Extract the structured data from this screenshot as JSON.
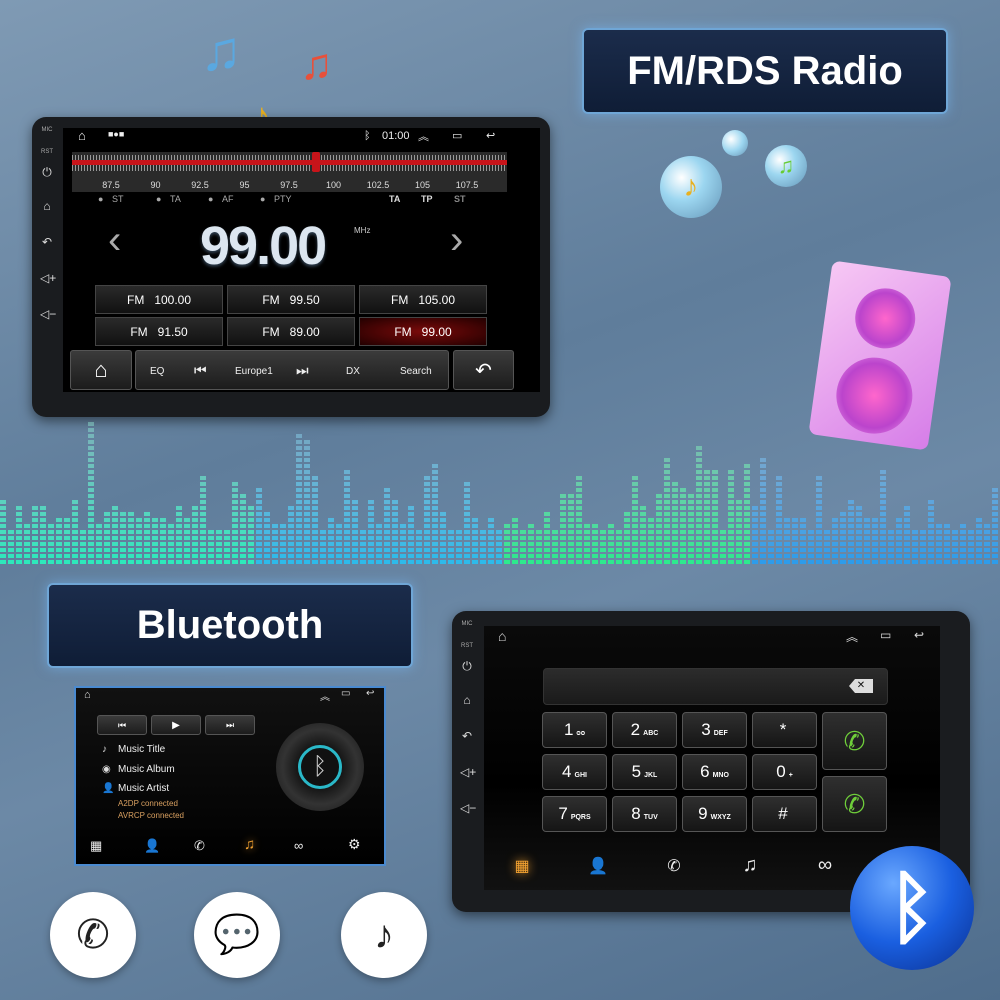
{
  "banners": {
    "radio": "FM/RDS Radio",
    "bluetooth": "Bluetooth"
  },
  "radio": {
    "side_labels": {
      "mic": "MIC",
      "rst": "RST"
    },
    "time": "01:00",
    "band_ticks": [
      "87.5",
      "90",
      "92.5",
      "95",
      "97.5",
      "100",
      "102.5",
      "105",
      "107.5"
    ],
    "tuner_value_mhz": 99.0,
    "indicators_left": [
      "ST",
      "TA",
      "AF",
      "PTY"
    ],
    "indicators_right": [
      "TA",
      "TP",
      "ST"
    ],
    "frequency": "99.00",
    "unit": "MHz",
    "presets": [
      {
        "band": "FM",
        "freq": "100.00"
      },
      {
        "band": "FM",
        "freq": "99.50"
      },
      {
        "band": "FM",
        "freq": "105.00"
      },
      {
        "band": "FM",
        "freq": "91.50"
      },
      {
        "band": "FM",
        "freq": "89.00"
      },
      {
        "band": "FM",
        "freq": "99.00",
        "selected": true
      }
    ],
    "bottom": {
      "eq": "EQ",
      "station": "Europe1",
      "dx": "DX",
      "search": "Search"
    }
  },
  "music": {
    "title": "Music Title",
    "album": "Music Album",
    "artist": "Music Artist",
    "status1": "A2DP connected",
    "status2": "AVRCP connected"
  },
  "dialer": {
    "side_labels": {
      "mic": "MIC",
      "rst": "RST"
    },
    "keys": [
      {
        "d": "1",
        "l": "ᴑᴑ"
      },
      {
        "d": "2",
        "l": "ABC"
      },
      {
        "d": "3",
        "l": "DEF"
      },
      {
        "d": "*",
        "l": ""
      },
      {
        "d": "4",
        "l": "GHI"
      },
      {
        "d": "5",
        "l": "JKL"
      },
      {
        "d": "6",
        "l": "MNO"
      },
      {
        "d": "0",
        "l": "+"
      },
      {
        "d": "7",
        "l": "PQRS"
      },
      {
        "d": "8",
        "l": "TUV"
      },
      {
        "d": "9",
        "l": "WXYZ"
      },
      {
        "d": "#",
        "l": ""
      }
    ]
  },
  "colors": {
    "accent_red": "#c8141a",
    "nav_active": "#f0a030",
    "call_green": "#6fcf3a",
    "bt_blue": "#1a5fe0"
  }
}
